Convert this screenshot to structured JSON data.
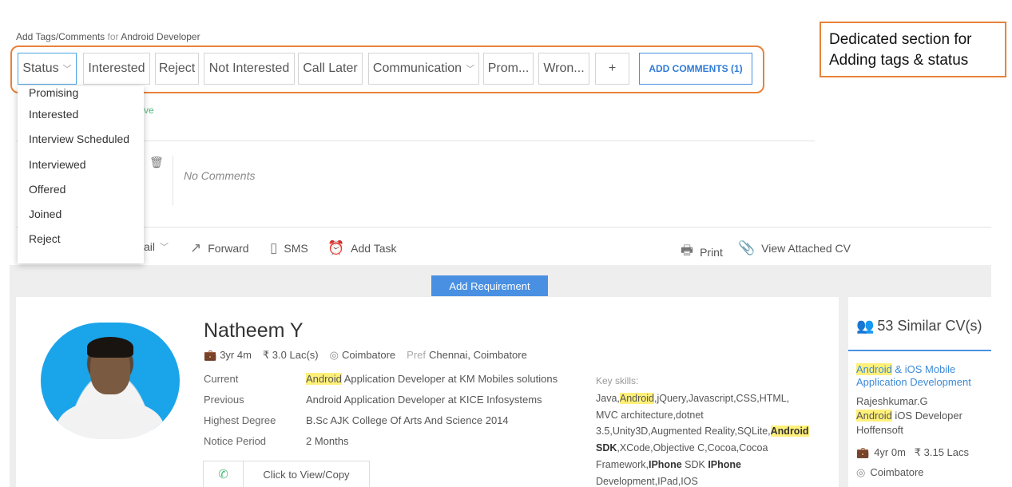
{
  "header": {
    "prefix": "Add Tags/Comments",
    "for_word": "for",
    "job_title": "Android Developer"
  },
  "callout": {
    "line1": "Dedicated section for",
    "line2": "Adding tags & status"
  },
  "tags": {
    "status": "Status",
    "interested": "Interested",
    "reject": "Reject",
    "not_interested": "Not Interested",
    "call_later": "Call Later",
    "communication": "Communication",
    "promising_trunc": "Prom...",
    "wrong_trunc": "Wron...",
    "plus": "+",
    "add_comments": "ADD COMMENTS (1)"
  },
  "status_dropdown": {
    "options": [
      "Promising",
      "Interested",
      "Interview Scheduled",
      "Interviewed",
      "Offered",
      "Joined",
      "Reject"
    ]
  },
  "comments": {
    "hidden_green": "ve",
    "no_comments": "No Comments"
  },
  "actions": {
    "mail": "ail",
    "forward": "Forward",
    "sms": "SMS",
    "add_task": "Add Task",
    "print": "Print",
    "view_cv": "View Attached CV"
  },
  "add_requirement": "Add Requirement",
  "candidate": {
    "name": "Natheem Y",
    "experience": "3yr 4m",
    "salary": "₹ 3.0 Lac(s)",
    "location": "Coimbatore",
    "pref_label": "Pref",
    "pref_locations": "Chennai, Coimbatore",
    "rows": [
      {
        "label": "Current",
        "value_hl": "Android",
        "value": " Application Developer at KM Mobiles solutions"
      },
      {
        "label": "Previous",
        "value_hl": "",
        "value": "Android Application Developer at KICE Infosystems"
      },
      {
        "label": "Highest Degree",
        "value_hl": "",
        "value": "B.Sc AJK College Of Arts And Science 2014"
      },
      {
        "label": "Notice Period",
        "value_hl": "",
        "value": "2 Months"
      }
    ],
    "contact_cta": "Click to View/Copy",
    "skills_label": "Key skills:",
    "skills": {
      "p1": "Java,",
      "android1": "Android",
      "p2": ",jQuery,Javascript,CSS,HTML, MVC architecture,dotnet 3.5,Unity3D,Augmented Reality,SQLite,",
      "android2": "Android",
      "sdk": " SDK",
      "p3": ",XCode,Objective C,Cocoa,Cocoa Framework,",
      "iphone1": "IPhone",
      "p4": " SDK ",
      "iphone2": "IPhone",
      "p5": " Development,IPad,IOS"
    }
  },
  "similar": {
    "title": "53 Similar CV(s)",
    "job_hl": "Android",
    "job_rest": " & iOS Mobile Application Development",
    "name": "Rajeshkumar.G",
    "role_hl": "Android",
    "role_rest": " iOS Developer",
    "company": "Hoffensoft",
    "experience": "4yr 0m",
    "salary": "₹  3.15 Lacs",
    "location": "Coimbatore"
  }
}
